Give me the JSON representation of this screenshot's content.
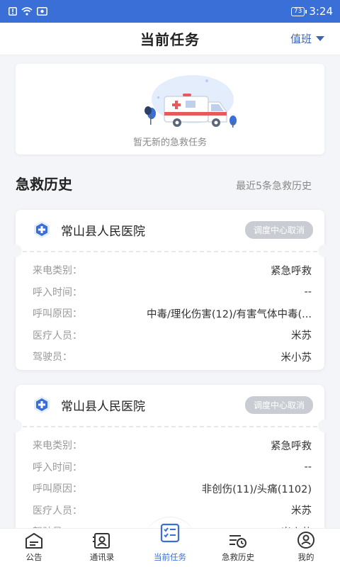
{
  "status_bar": {
    "time": "3:24",
    "battery": "73"
  },
  "header": {
    "title": "当前任务",
    "duty_label": "值班"
  },
  "empty_state": {
    "text": "暂无新的急救任务"
  },
  "history": {
    "title": "急救历史",
    "subtitle": "最近5条急救历史",
    "labels": {
      "call_type": "来电类别：",
      "call_time": "呼入时间：",
      "reason": "呼叫原因：",
      "medic": "医疗人员：",
      "driver": "驾驶员："
    },
    "records": [
      {
        "hospital": "常山县人民医院",
        "status": "调度中心取消",
        "call_type": "紧急呼救",
        "call_time": "--",
        "reason": "中毒/理化伤害(12)/有害气体中毒(...",
        "medic": "米苏",
        "driver": "米小苏"
      },
      {
        "hospital": "常山县人民医院",
        "status": "调度中心取消",
        "call_type": "紧急呼救",
        "call_time": "--",
        "reason": "非创伤(11)/头痛(1102)",
        "medic": "米苏",
        "driver": "米小苏"
      }
    ]
  },
  "tabs": [
    {
      "label": "公告",
      "icon": "announcement-icon"
    },
    {
      "label": "通讯录",
      "icon": "contacts-icon"
    },
    {
      "label": "当前任务",
      "icon": "task-list-icon"
    },
    {
      "label": "急救历史",
      "icon": "history-icon"
    },
    {
      "label": "我的",
      "icon": "profile-icon"
    }
  ],
  "colors": {
    "primary": "#3b6fd8",
    "badge": "#c9ccd3"
  }
}
